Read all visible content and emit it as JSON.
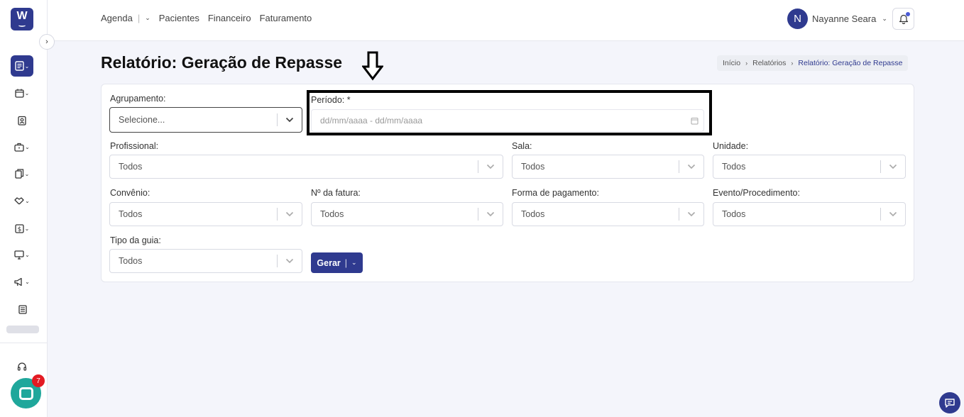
{
  "app": {
    "logo_letter": "W",
    "chat_badge": "7"
  },
  "topnav": {
    "items": [
      "Agenda",
      "Pacientes",
      "Financeiro",
      "Faturamento"
    ],
    "separator": "|"
  },
  "user": {
    "initial": "N",
    "name": "Nayanne Seara"
  },
  "page": {
    "title": "Relatório: Geração de Repasse"
  },
  "breadcrumb": {
    "items": [
      "Início",
      "Relatórios",
      "Relatório: Geração de Repasse"
    ]
  },
  "form": {
    "agrupamento": {
      "label": "Agrupamento:",
      "placeholder": "Selecione..."
    },
    "periodo": {
      "label": "Período: *",
      "placeholder": "dd/mm/aaaa - dd/mm/aaaa"
    },
    "profissional": {
      "label": "Profissional:",
      "value": "Todos"
    },
    "sala": {
      "label": "Sala:",
      "value": "Todos"
    },
    "unidade": {
      "label": "Unidade:",
      "value": "Todos"
    },
    "convenio": {
      "label": "Convênio:",
      "value": "Todos"
    },
    "fatura": {
      "label": "Nº da fatura:",
      "value": "Todos"
    },
    "pagamento": {
      "label": "Forma de pagamento:",
      "value": "Todos"
    },
    "evento": {
      "label": "Evento/Procedimento:",
      "value": "Todos"
    },
    "guia": {
      "label": "Tipo da guia:",
      "value": "Todos"
    },
    "gerar": {
      "label": "Gerar",
      "separator": "|"
    }
  },
  "colors": {
    "primary": "#2f3a8f",
    "chat": "#1fa79b",
    "badge": "#e31b23"
  }
}
